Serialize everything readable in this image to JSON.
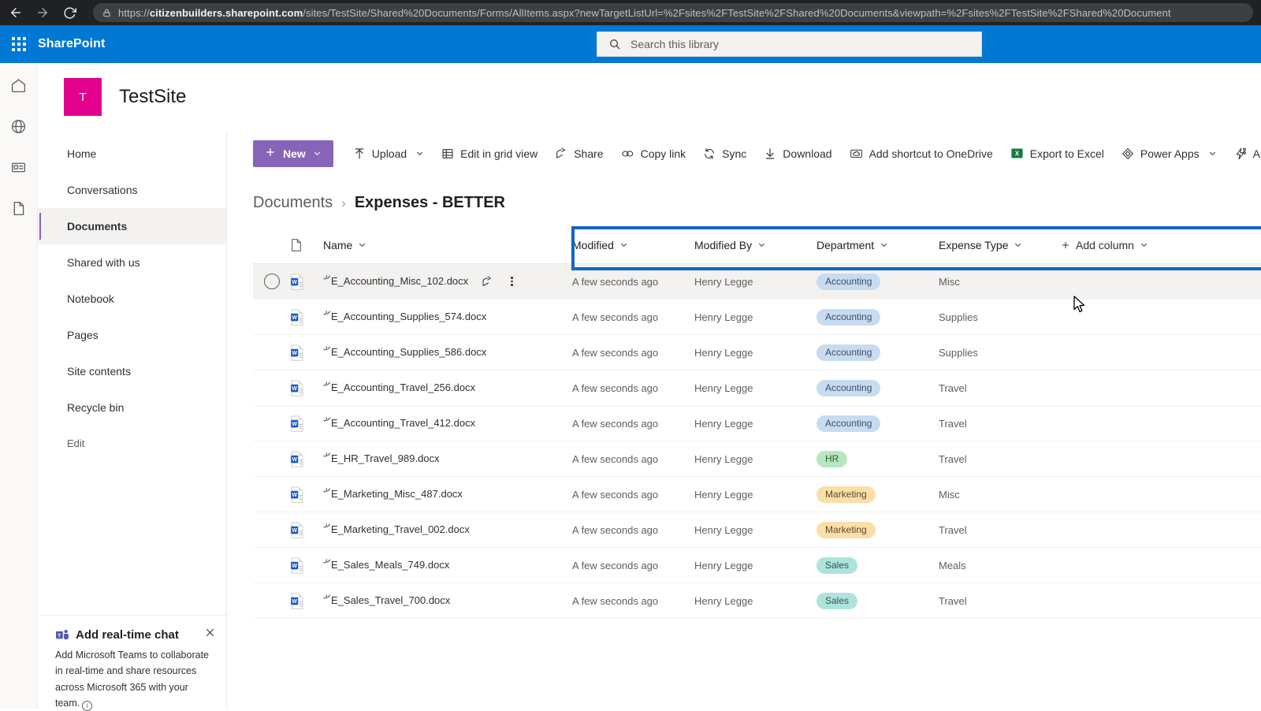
{
  "browser": {
    "back_icon": "back-arrow-icon",
    "forward_icon": "forward-arrow-icon",
    "reload_icon": "reload-icon",
    "lock_icon": "lock-icon",
    "url_prefix": "https://",
    "url_domain": "citizenbuilders.sharepoint.com",
    "url_path": "/sites/TestSite/Shared%20Documents/Forms/AllItems.aspx?newTargetListUrl=%2Fsites%2FTestSite%2FShared%20Documents&viewpath=%2Fsites%2FTestSite%2FShared%20Document"
  },
  "suite": {
    "waffle_icon": "app-launcher-icon",
    "brand": "SharePoint",
    "search_icon": "search-icon",
    "search_placeholder": "Search this library"
  },
  "rail": {
    "items": [
      {
        "icon": "home-icon"
      },
      {
        "icon": "globe-icon"
      },
      {
        "icon": "news-icon"
      },
      {
        "icon": "document-icon"
      }
    ]
  },
  "site": {
    "logo_letter": "T",
    "logo_color": "#e3008c",
    "title": "TestSite"
  },
  "sidebar": {
    "items": [
      {
        "label": "Home",
        "selected": false
      },
      {
        "label": "Conversations",
        "selected": false
      },
      {
        "label": "Documents",
        "selected": true
      },
      {
        "label": "Shared with us",
        "selected": false
      },
      {
        "label": "Notebook",
        "selected": false
      },
      {
        "label": "Pages",
        "selected": false
      },
      {
        "label": "Site contents",
        "selected": false
      },
      {
        "label": "Recycle bin",
        "selected": false
      }
    ],
    "edit_label": "Edit"
  },
  "teams_callout": {
    "title": "Add real-time chat",
    "body": "Add Microsoft Teams to collaborate in real-time and share resources across Microsoft 365 with your team.",
    "close_icon": "close-icon",
    "teams_icon": "teams-icon",
    "info_icon": "info-icon"
  },
  "toolbar": {
    "new_label": "New",
    "new_icon": "plus-icon",
    "commands": [
      {
        "label": "Upload",
        "icon": "upload-icon",
        "caret": true
      },
      {
        "label": "Edit in grid view",
        "icon": "grid-icon",
        "caret": false
      },
      {
        "label": "Share",
        "icon": "share-icon",
        "caret": false
      },
      {
        "label": "Copy link",
        "icon": "link-icon",
        "caret": false
      },
      {
        "label": "Sync",
        "icon": "sync-icon",
        "caret": false
      },
      {
        "label": "Download",
        "icon": "download-icon",
        "caret": false
      },
      {
        "label": "Add shortcut to OneDrive",
        "icon": "onedrive-shortcut-icon",
        "caret": false
      },
      {
        "label": "Export to Excel",
        "icon": "excel-icon",
        "caret": false
      },
      {
        "label": "Power Apps",
        "icon": "powerapps-icon",
        "caret": true
      },
      {
        "label": "Automate",
        "icon": "automate-icon",
        "caret": true
      }
    ]
  },
  "breadcrumb": {
    "root": "Documents",
    "separator": "›",
    "current": "Expenses - BETTER"
  },
  "table": {
    "file_type_header_icon": "document-icon",
    "columns": [
      {
        "label": "Name",
        "caret": true
      },
      {
        "label": "Modified",
        "caret": true
      },
      {
        "label": "Modified By",
        "caret": true
      },
      {
        "label": "Department",
        "caret": true
      },
      {
        "label": "Expense Type",
        "caret": true
      }
    ],
    "add_column_label": "Add column",
    "rows": [
      {
        "name": "E_Accounting_Misc_102.docx",
        "modified": "A few seconds ago",
        "modified_by": "Henry Legge",
        "department": "Accounting",
        "dept_class": "pill-accounting",
        "expense_type": "Misc",
        "hover": true
      },
      {
        "name": "E_Accounting_Supplies_574.docx",
        "modified": "A few seconds ago",
        "modified_by": "Henry Legge",
        "department": "Accounting",
        "dept_class": "pill-accounting",
        "expense_type": "Supplies",
        "hover": false
      },
      {
        "name": "E_Accounting_Supplies_586.docx",
        "modified": "A few seconds ago",
        "modified_by": "Henry Legge",
        "department": "Accounting",
        "dept_class": "pill-accounting",
        "expense_type": "Supplies",
        "hover": false
      },
      {
        "name": "E_Accounting_Travel_256.docx",
        "modified": "A few seconds ago",
        "modified_by": "Henry Legge",
        "department": "Accounting",
        "dept_class": "pill-accounting",
        "expense_type": "Travel",
        "hover": false
      },
      {
        "name": "E_Accounting_Travel_412.docx",
        "modified": "A few seconds ago",
        "modified_by": "Henry Legge",
        "department": "Accounting",
        "dept_class": "pill-accounting",
        "expense_type": "Travel",
        "hover": false
      },
      {
        "name": "E_HR_Travel_989.docx",
        "modified": "A few seconds ago",
        "modified_by": "Henry Legge",
        "department": "HR",
        "dept_class": "pill-hr",
        "expense_type": "Travel",
        "hover": false
      },
      {
        "name": "E_Marketing_Misc_487.docx",
        "modified": "A few seconds ago",
        "modified_by": "Henry Legge",
        "department": "Marketing",
        "dept_class": "pill-marketing",
        "expense_type": "Misc",
        "hover": false
      },
      {
        "name": "E_Marketing_Travel_002.docx",
        "modified": "A few seconds ago",
        "modified_by": "Henry Legge",
        "department": "Marketing",
        "dept_class": "pill-marketing",
        "expense_type": "Travel",
        "hover": false
      },
      {
        "name": "E_Sales_Meals_749.docx",
        "modified": "A few seconds ago",
        "modified_by": "Henry Legge",
        "department": "Sales",
        "dept_class": "pill-sales",
        "expense_type": "Meals",
        "hover": false
      },
      {
        "name": "E_Sales_Travel_700.docx",
        "modified": "A few seconds ago",
        "modified_by": "Henry Legge",
        "department": "Sales",
        "dept_class": "pill-sales",
        "expense_type": "Travel",
        "hover": false
      }
    ],
    "row_share_icon": "share-icon",
    "row_more_icon": "more-options-icon",
    "file_icon": "word-document-icon",
    "new_badge_icon": "new-sparkle-icon",
    "select_icon": "selection-circle-icon"
  },
  "annotation": {
    "highlight_color": "#1565c0"
  },
  "cursor": {
    "icon": "mouse-pointer-icon"
  }
}
